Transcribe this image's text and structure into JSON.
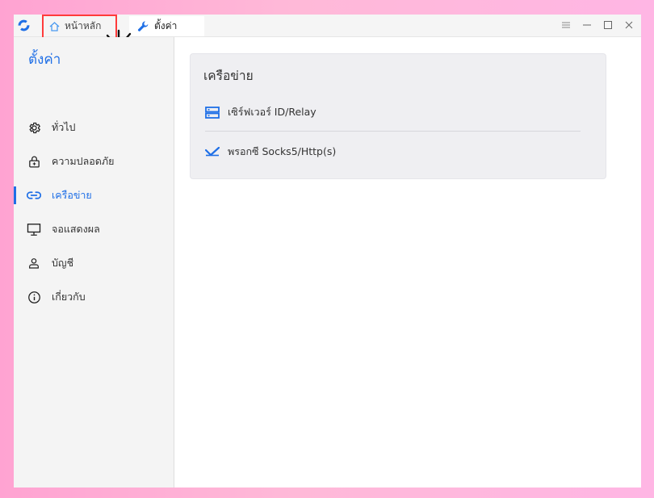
{
  "tabs": [
    {
      "label": "หน้าหลัก",
      "icon": "home-icon"
    },
    {
      "label": "ตั้งค่า",
      "icon": "wrench-icon"
    }
  ],
  "window_controls": [
    "menu-icon",
    "minimize-icon",
    "maximize-icon",
    "close-icon"
  ],
  "sidebar": {
    "title": "ตั้งค่า",
    "items": [
      {
        "label": "ทั่วไป",
        "icon": "gear-icon"
      },
      {
        "label": "ความปลอดภัย",
        "icon": "lock-icon"
      },
      {
        "label": "เครือข่าย",
        "icon": "link-icon",
        "active": true
      },
      {
        "label": "จอแสดงผล",
        "icon": "monitor-icon"
      },
      {
        "label": "บัญชี",
        "icon": "user-icon"
      },
      {
        "label": "เกี่ยวกับ",
        "icon": "info-icon"
      }
    ]
  },
  "main": {
    "section_title": "เครือข่าย",
    "rows": [
      {
        "label": "เซิร์ฟเวอร์ ID/Relay",
        "icon": "server-icon"
      },
      {
        "label": "พรอกซี Socks5/Http(s)",
        "icon": "proxy-icon"
      }
    ]
  },
  "colors": {
    "accent": "#1f6fe6",
    "highlight": "#ff3b3b"
  }
}
